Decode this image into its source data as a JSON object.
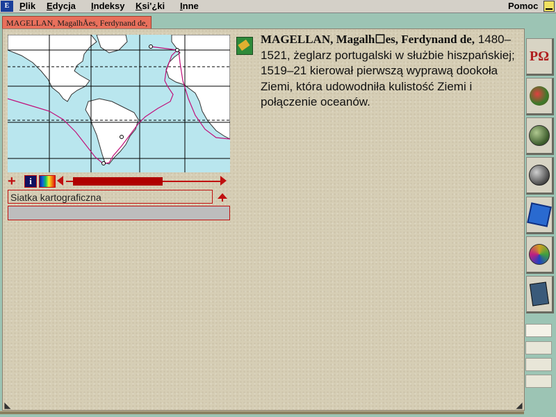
{
  "app": {
    "icon_label": "E",
    "menu": [
      {
        "label": "Plik",
        "underline_index": 0
      },
      {
        "label": "Edycja",
        "underline_index": 0
      },
      {
        "label": "Indeksy",
        "underline_index": 0
      },
      {
        "label": "Ksi'¿ki",
        "underline_index": 0
      },
      {
        "label": "Inne",
        "underline_index": 0
      }
    ],
    "help_label": "Pomoc"
  },
  "tab": {
    "label": "MAGELLAN, MagalhÅes, Ferdynand de,"
  },
  "map": {
    "caption": "Siatka kartograficzna",
    "controls": [
      "plus-icon",
      "info-icon",
      "palette-icon",
      "rewind-icon",
      "forward-icon"
    ],
    "progress": 0.58,
    "ocean_color": "#b9e6ee",
    "land_color": "#ffffff",
    "route_color": "#c0107a"
  },
  "article": {
    "headword": "MAGELLAN, Magalh☐es, Ferdynand de,",
    "body": "1480–1521, żeglarz portugalski w służbie hiszpańskiej; 1519–21 kierował pierwszą wyprawą dookoła Ziemi, która udowodniła kulistość Ziemi i połączenie oceanów."
  },
  "sidebar": {
    "buttons": [
      {
        "name": "alphabet-omega-icon",
        "label": "ΡΩ"
      },
      {
        "name": "fruit-tree-icon"
      },
      {
        "name": "globe-clock-icon"
      },
      {
        "name": "globe-icon"
      },
      {
        "name": "dice-icon"
      },
      {
        "name": "compact-disc-icon"
      },
      {
        "name": "notebook-pen-icon"
      }
    ]
  }
}
